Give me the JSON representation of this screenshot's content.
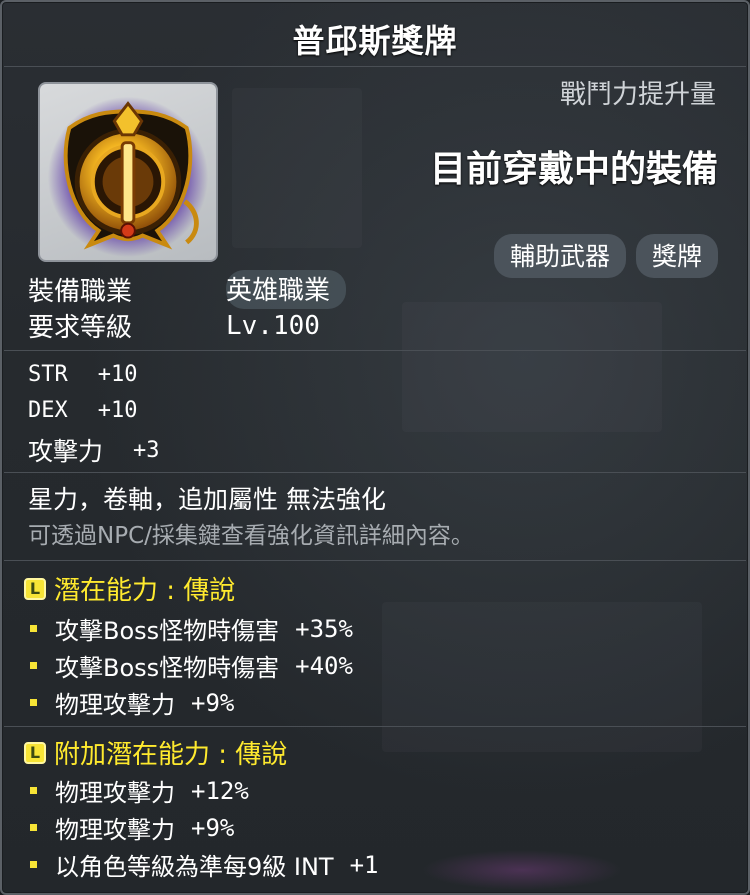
{
  "item": {
    "name": "普邱斯獎牌"
  },
  "header": {
    "power_label": "戰鬥力提升量",
    "equipped_text": "目前穿戴中的裝備",
    "tags": [
      "輔助武器",
      "獎牌"
    ]
  },
  "requirements": {
    "job_label": "裝備職業",
    "job_value": "英雄職業",
    "level_label": "要求等級",
    "level_value": "Lv.100"
  },
  "stats": [
    {
      "name": "STR",
      "value": "+10"
    },
    {
      "name": "DEX",
      "value": "+10"
    },
    {
      "name": "攻擊力",
      "value": "+3"
    }
  ],
  "notes": {
    "no_enhance": "星力，卷軸，追加屬性 無法強化",
    "npc_hint": "可透過NPC/採集鍵查看強化資訊詳細內容。"
  },
  "potential": {
    "grade_icon": "L",
    "header": "潛在能力 : 傳說",
    "lines": [
      {
        "name": "攻擊Boss怪物時傷害",
        "value": "+35%"
      },
      {
        "name": "攻擊Boss怪物時傷害",
        "value": "+40%"
      },
      {
        "name": "物理攻擊力",
        "value": "+9%"
      }
    ]
  },
  "additional_potential": {
    "grade_icon": "L",
    "header": "附加潛在能力 : 傳說",
    "lines": [
      {
        "name": "物理攻擊力",
        "value": "+12%"
      },
      {
        "name": "物理攻擊力",
        "value": "+9%"
      },
      {
        "name": "以角色等級為準每9級 INT",
        "value": "+1"
      }
    ]
  },
  "colors": {
    "legendary": "#ffea2e",
    "legendary_badge": "#f7e436",
    "text": "#ffffff",
    "muted": "#a7acb1",
    "tag_bg": "#4b535b"
  }
}
